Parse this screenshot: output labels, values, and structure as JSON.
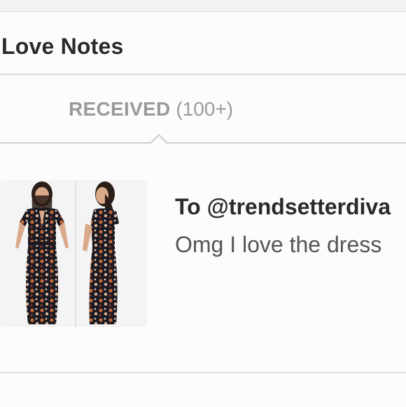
{
  "header": {
    "title": "Love Notes"
  },
  "tabs": {
    "received_label": "RECEIVED",
    "received_count": "(100+)"
  },
  "note": {
    "to_line": "To @trendsetterdiva",
    "message": "Omg I love the dress",
    "thumbnail_icon": "dress-photo-icon"
  },
  "colors": {
    "page_background": "#f3f1f2",
    "card_background": "#fdfcfc",
    "title_text": "#2a2a2c",
    "tab_text": "#9b9a9a",
    "message_text": "#555456",
    "divider": "#dad8d9"
  }
}
